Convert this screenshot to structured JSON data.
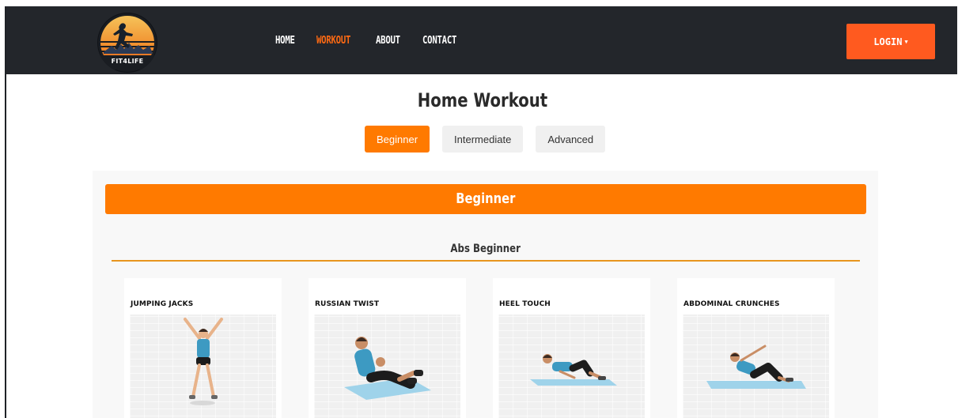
{
  "brand": {
    "logo_text": "FIT4LIFE"
  },
  "nav": {
    "links": [
      {
        "label": "HOME",
        "active": false
      },
      {
        "label": "WORKOUT",
        "active": true
      },
      {
        "label": "ABOUT",
        "active": false
      },
      {
        "label": "CONTACT",
        "active": false
      }
    ],
    "login_label": "LOGIN",
    "login_icon": "caret-down-icon"
  },
  "page": {
    "title": "Home Workout",
    "level_tabs": [
      {
        "label": "Beginner",
        "active": true
      },
      {
        "label": "Intermediate",
        "active": false
      },
      {
        "label": "Advanced",
        "active": false
      }
    ]
  },
  "content": {
    "level_banner": "Beginner",
    "section_title": "Abs Beginner",
    "exercises": [
      {
        "title": "JUMPING JACKS",
        "icon": "jumping-jacks-illustration"
      },
      {
        "title": "RUSSIAN TWIST",
        "icon": "russian-twist-illustration"
      },
      {
        "title": "HEEL TOUCH",
        "icon": "heel-touch-illustration"
      },
      {
        "title": "ABDOMINAL CRUNCHES",
        "icon": "abdominal-crunches-illustration"
      }
    ]
  },
  "colors": {
    "navbar_bg": "#23262b",
    "accent": "#ff7a00",
    "login_bg": "#ff5a1f",
    "active_nav": "#ff6a13"
  }
}
